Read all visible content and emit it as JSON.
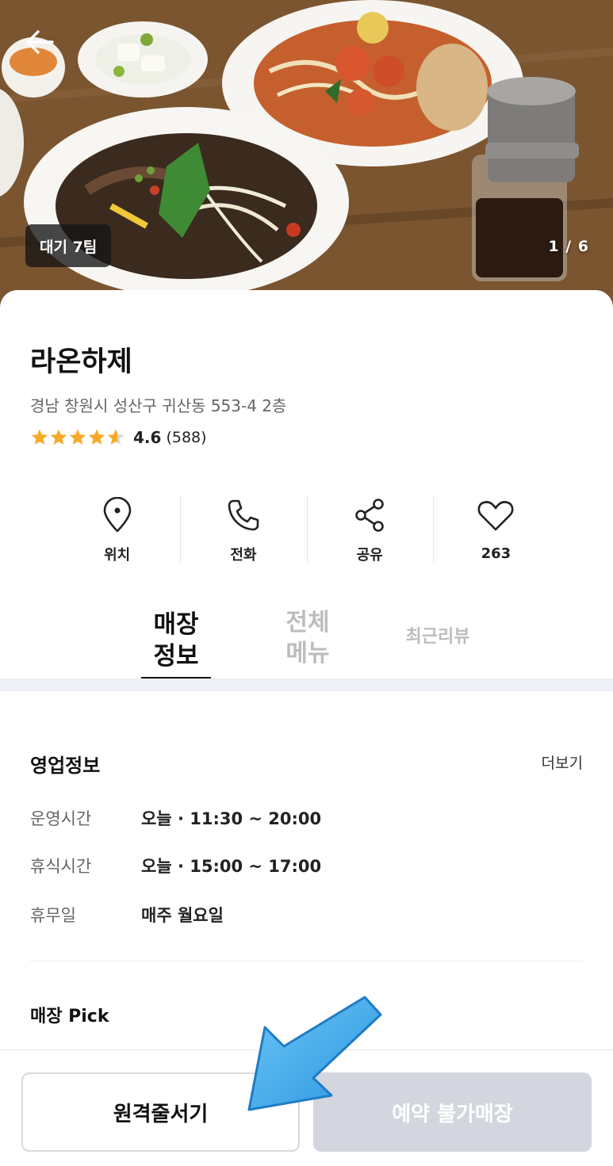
{
  "hero": {
    "wait_badge": "대기 7팀",
    "photo_counter": "1 / 6"
  },
  "store": {
    "name": "라온하제",
    "address": "경남 창원시 성산구 귀산동 553-4 2층",
    "rating": "4.6",
    "rating_count": "(588)",
    "star_fill": 0.92
  },
  "actions": [
    {
      "label": "위치",
      "icon": "location-pin-icon"
    },
    {
      "label": "전화",
      "icon": "phone-icon"
    },
    {
      "label": "공유",
      "icon": "share-icon"
    },
    {
      "label": "263",
      "icon": "heart-icon"
    }
  ],
  "tabs": {
    "store_info_line1": "매장",
    "store_info_line2": "정보",
    "menu_line1": "전체",
    "menu_line2": "메뉴",
    "reviews": "최근리뷰"
  },
  "business": {
    "title": "영업정보",
    "more": "더보기",
    "rows": [
      {
        "label": "운영시간",
        "value": "오늘 · 11:30 ~ 20:00"
      },
      {
        "label": "휴식시간",
        "value": "오늘 · 15:00 ~ 17:00"
      },
      {
        "label": "휴무일",
        "value": "매주 월요일"
      }
    ],
    "pick_title": "매장 Pick"
  },
  "bottom": {
    "remote_queue": "원격줄서기",
    "reserve": "예약 불가매장"
  },
  "colors": {
    "star": "#f7a928",
    "arrow": "#3fa8ea",
    "disabled_button": "#d3d6de"
  }
}
